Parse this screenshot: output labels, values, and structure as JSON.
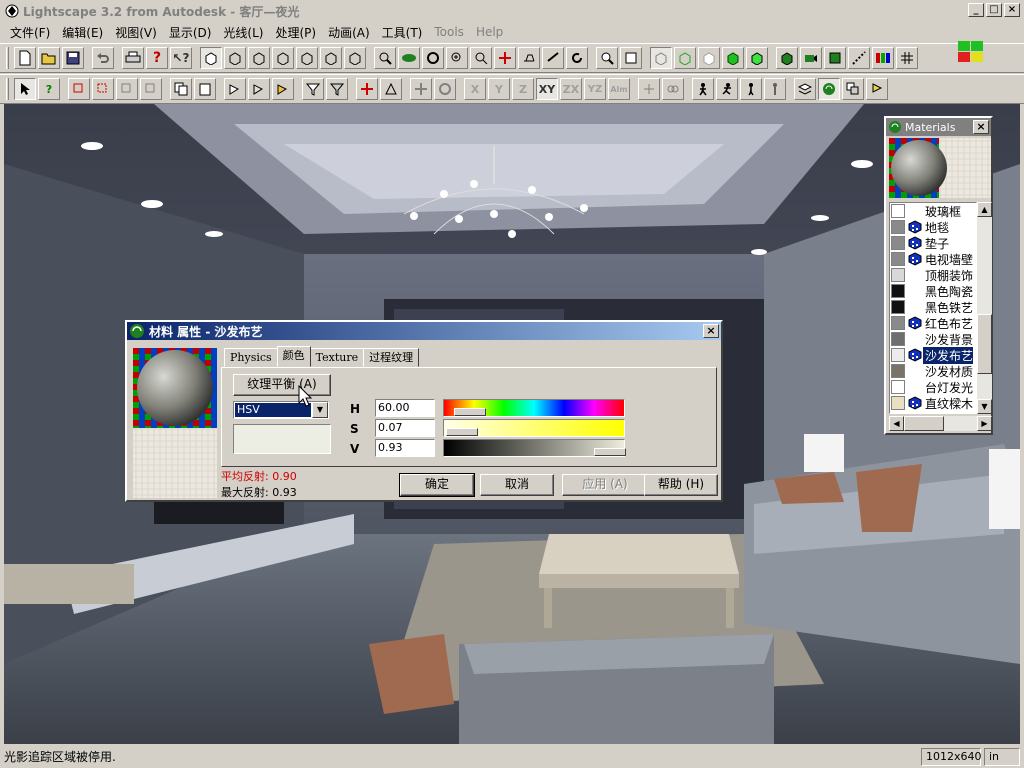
{
  "window": {
    "title": "Lightscape 3.2 from Autodesk - 客厅—夜光",
    "min": "_",
    "max": "□",
    "close": "×"
  },
  "menu": [
    {
      "label": "文件(F)",
      "disabled": false
    },
    {
      "label": "编辑(E)",
      "disabled": false
    },
    {
      "label": "视图(V)",
      "disabled": false
    },
    {
      "label": "显示(D)",
      "disabled": false
    },
    {
      "label": "光线(L)",
      "disabled": false
    },
    {
      "label": "处理(P)",
      "disabled": false
    },
    {
      "label": "动画(A)",
      "disabled": false
    },
    {
      "label": "工具(T)",
      "disabled": false
    },
    {
      "label": "Tools",
      "disabled": true
    },
    {
      "label": "Help",
      "disabled": true
    }
  ],
  "toolbar2_axes": [
    "X",
    "Y",
    "Z",
    "XY",
    "ZX",
    "YZ",
    "Alm"
  ],
  "dialog": {
    "title": "材料 属性 - 沙发布艺",
    "tabs": [
      "Physics",
      "颜色",
      "Texture",
      "过程纹理"
    ],
    "active_tab": "颜色",
    "texture_balance_button": "纹理平衡 (A)",
    "color_model": "HSV",
    "h_label": "H",
    "s_label": "S",
    "v_label": "V",
    "h_value": "60.00",
    "s_value": "0.07",
    "v_value": "0.93",
    "avg_reflect": "平均反射: 0.90",
    "max_reflect": "最大反射: 0.93",
    "buttons": {
      "ok": "确定",
      "cancel": "取消",
      "apply": "应用 (A)",
      "help": "帮助 (H)"
    },
    "close": "×"
  },
  "materials_panel": {
    "title": "Materials",
    "close": "×",
    "items": [
      {
        "label": "玻璃框",
        "color": "#ffffff",
        "textured": false,
        "selected": false
      },
      {
        "label": "地毯",
        "color": "#8a8a8a",
        "textured": true,
        "selected": false
      },
      {
        "label": "垫子",
        "color": "#8a8a8a",
        "textured": true,
        "selected": false
      },
      {
        "label": "电视墙壁",
        "color": "#8a8a8a",
        "textured": true,
        "selected": false
      },
      {
        "label": "顶棚装饰",
        "color": "#d8d8d8",
        "textured": false,
        "selected": false
      },
      {
        "label": "黑色陶瓷",
        "color": "#101010",
        "textured": false,
        "selected": false
      },
      {
        "label": "黑色铁艺",
        "color": "#101010",
        "textured": false,
        "selected": false
      },
      {
        "label": "红色布艺",
        "color": "#8a8a8a",
        "textured": true,
        "selected": false
      },
      {
        "label": "沙发背景",
        "color": "#6e6e6e",
        "textured": false,
        "selected": false
      },
      {
        "label": "沙发布艺",
        "color": "#ececec",
        "textured": true,
        "selected": true
      },
      {
        "label": "沙发材质",
        "color": "#7a7468",
        "textured": false,
        "selected": false
      },
      {
        "label": "台灯发光",
        "color": "#ffffff",
        "textured": false,
        "selected": false
      },
      {
        "label": "直纹樑木",
        "color": "#e8e0c0",
        "textured": true,
        "selected": false
      }
    ]
  },
  "status": {
    "message": "光影追踪区域被停用.",
    "resolution": "1012x640",
    "units": "in"
  }
}
